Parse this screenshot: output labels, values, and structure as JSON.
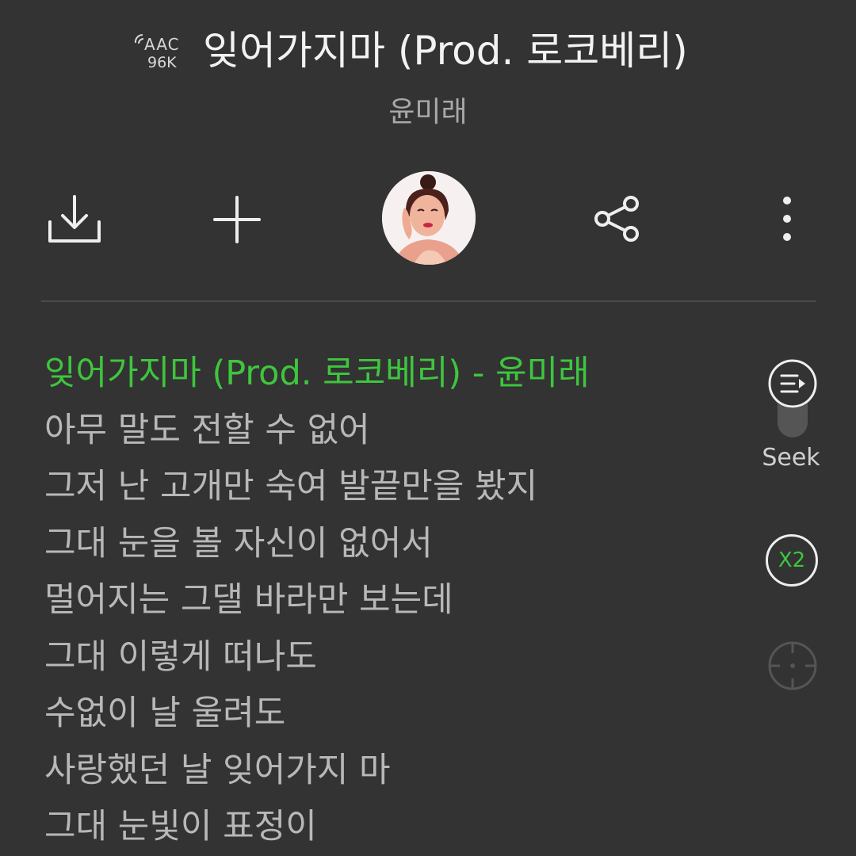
{
  "header": {
    "quality": {
      "codec": "AAC",
      "bitrate": "96K"
    },
    "title": "잊어가지마 (Prod. 로코베리)",
    "artist": "윤미래"
  },
  "toolbar": {
    "download_icon": "download-icon",
    "add_icon": "plus-icon",
    "share_icon": "share-icon",
    "more_icon": "more-vertical-icon"
  },
  "lyrics": {
    "current_line": "잊어가지마 (Prod. 로코베리) - 윤미래",
    "lines": [
      "아무 말도 전할 수 없어",
      "그저 난 고개만 숙여 발끝만을 봤지",
      "그대 눈을 볼 자신이 없어서",
      "멀어지는 그댈 바라만 보는데",
      "그대 이렇게 떠나도",
      "수없이 날 울려도",
      "사랑했던 날 잊어가지 마",
      "그대 눈빛이 표정이"
    ]
  },
  "side_controls": {
    "seek_label": "Seek",
    "speed_label": "X2"
  },
  "colors": {
    "background": "#333333",
    "accent": "#3ec63e",
    "lyric_text": "#b8b8b8"
  }
}
